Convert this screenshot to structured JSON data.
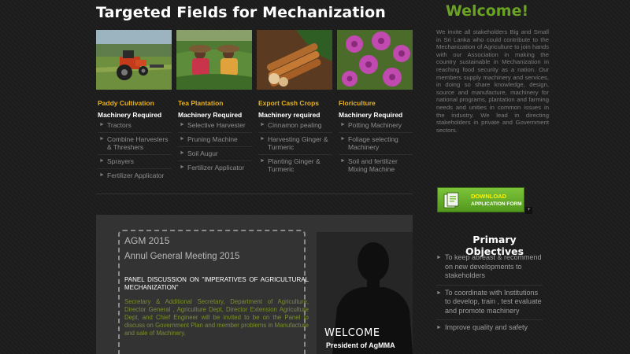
{
  "main": {
    "title": "Targeted Fields for Mechanization",
    "fields": [
      {
        "title": "Paddy Cultivation",
        "heading": "Machinery Required",
        "items": [
          "Tractors",
          "Combine Harvesters & Threshers",
          "Sprayers",
          "Fertilizer Applicator"
        ]
      },
      {
        "title": "Tea Plantation",
        "heading": "Machinery Required",
        "items": [
          "Selective Harvester",
          "Pruning Machine",
          "Soil Augur",
          "Fertilizer Applicator"
        ]
      },
      {
        "title": "Export Cash Crops",
        "heading": "Machinery required",
        "items": [
          "Cinnamon pealing",
          "Harvesting Ginger & Turmeric",
          "Planting Ginger & Turmeric"
        ]
      },
      {
        "title": "Floriculture",
        "heading": "Machinery Required",
        "items": [
          "Potting Machinery",
          "Foliage selecting Machinery",
          "Soil and fertilizer Mixing Machine"
        ]
      }
    ],
    "feature": {
      "year": "AGM 2015",
      "subtitle": "Annul General Meeting 2015",
      "panel_heading": "PANEL DISCUSSION ON \"IMPERATIVES OF AGRICULTURAL MECHANIZATION\"",
      "panel_body": "Secretary & Additional Secretary, Department of Agriculture, Director General , Agriculture Dept, Director Extension Agriculture Dept, and Chief Engineer will be invited to be on the Panel to discuss on Government Plan and member problems in Manufacture and sale of Machinery.",
      "welcome": "WELCOME",
      "president": "President of AgMMA"
    }
  },
  "sidebar": {
    "welcome_title": "Welcome!",
    "welcome_text": "We invite all stakeholders Big and Small in Sri Lanka who could contribute to the Mechanization of Agriculture to join hands with our Association in making the country sustainable in Mechanization in reaching food security as a nation. Our members supply machinery and services, in doing so share knowledge, design, source and manufacture, machinery for national programs, plantation and farming needs and unities in common issues in the industry. We lead in directing stakeholders in private and Government sectors.",
    "download": {
      "line1": "DOWNLOAD",
      "line2": "APPLICATION FORM"
    },
    "objectives_title": "Primary Objectives",
    "objectives": [
      "To keep abreast & recommend on new developments to stakeholders",
      "To coordinate with Institutions to develop, train , test evaluate and promote machinery",
      "Improve quality and safety"
    ]
  },
  "colors": {
    "accent_yellow": "#e8b21e",
    "accent_green": "#6aa323",
    "panel_text_green": "#7a8f2c",
    "background": "#1c1c1c"
  },
  "icons": [
    "chevron-right-icon",
    "download-form-icon",
    "president-silhouette-icon"
  ]
}
